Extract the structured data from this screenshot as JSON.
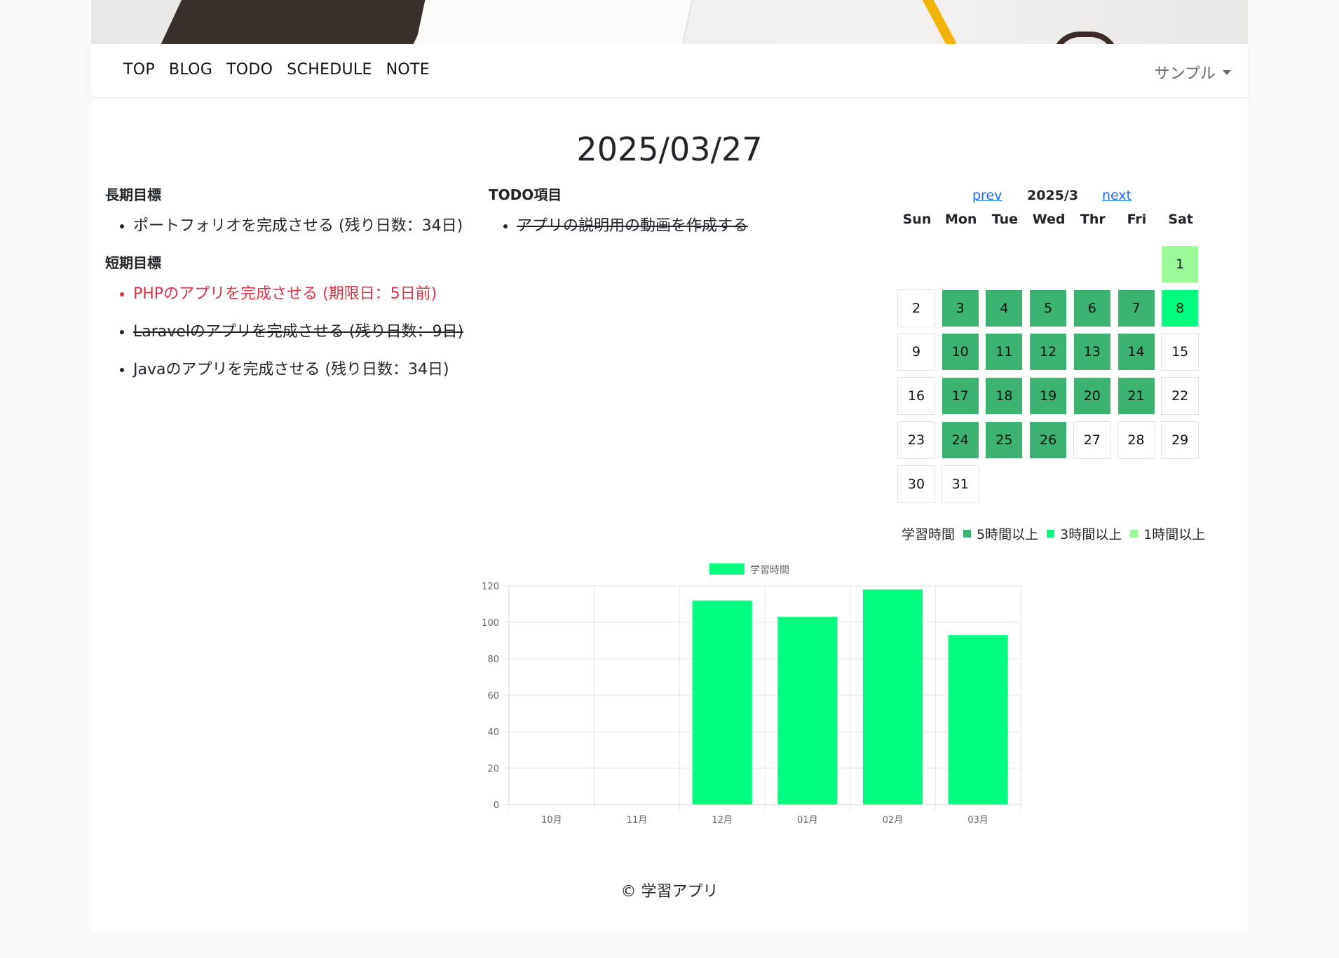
{
  "nav": {
    "links": [
      "TOP",
      "BLOG",
      "TODO",
      "SCHEDULE",
      "NOTE"
    ],
    "user": "サンプル"
  },
  "date_title": "2025/03/27",
  "long_term": {
    "heading": "長期目標",
    "items": [
      {
        "text": "ポートフォリオを完成させる (残り日数：34日)",
        "done": false,
        "overdue": false
      }
    ]
  },
  "short_term": {
    "heading": "短期目標",
    "items": [
      {
        "text": "PHPのアプリを完成させる (期限日：5日前)",
        "done": false,
        "overdue": true
      },
      {
        "text": "Laravelのアプリを完成させる (残り日数：9日)",
        "done": true,
        "overdue": false
      },
      {
        "text": "Javaのアプリを完成させる (残り日数：34日)",
        "done": false,
        "overdue": false
      }
    ]
  },
  "todo": {
    "heading": "TODO項目",
    "items": [
      {
        "text": "アプリの説明用の動画を作成する",
        "done": true
      }
    ]
  },
  "calendar": {
    "prev": "prev",
    "month": "2025/3",
    "next": "next",
    "day_names": [
      "Sun",
      "Mon",
      "Tue",
      "Wed",
      "Thr",
      "Fri",
      "Sat"
    ],
    "first_weekday": 6,
    "days_in_month": 31,
    "levels": {
      "1": "lvl1",
      "3": "lvl5",
      "4": "lvl5",
      "5": "lvl5",
      "6": "lvl5",
      "7": "lvl5",
      "8": "lvl3",
      "10": "lvl5",
      "11": "lvl5",
      "12": "lvl5",
      "13": "lvl5",
      "14": "lvl5",
      "17": "lvl5",
      "18": "lvl5",
      "19": "lvl5",
      "20": "lvl5",
      "21": "lvl5",
      "24": "lvl5",
      "25": "lvl5",
      "26": "lvl5"
    },
    "legend": {
      "title": "学習時間",
      "items": [
        {
          "label": "5時間以上",
          "color": "#3cb371"
        },
        {
          "label": "3時間以上",
          "color": "#00ff7f"
        },
        {
          "label": "1時間以上",
          "color": "#98fb98"
        }
      ]
    }
  },
  "chart_data": {
    "type": "bar",
    "categories": [
      "10月",
      "11月",
      "12月",
      "01月",
      "02月",
      "03月"
    ],
    "series": [
      {
        "name": "学習時間",
        "values": [
          0,
          0,
          112,
          103,
          118,
          93
        ],
        "color": "#00ff7f"
      }
    ],
    "ylim": [
      0,
      120
    ],
    "yticks": [
      0,
      20,
      40,
      60,
      80,
      100,
      120
    ],
    "grid": true,
    "legend": "top"
  },
  "footer": "© 学習アプリ"
}
